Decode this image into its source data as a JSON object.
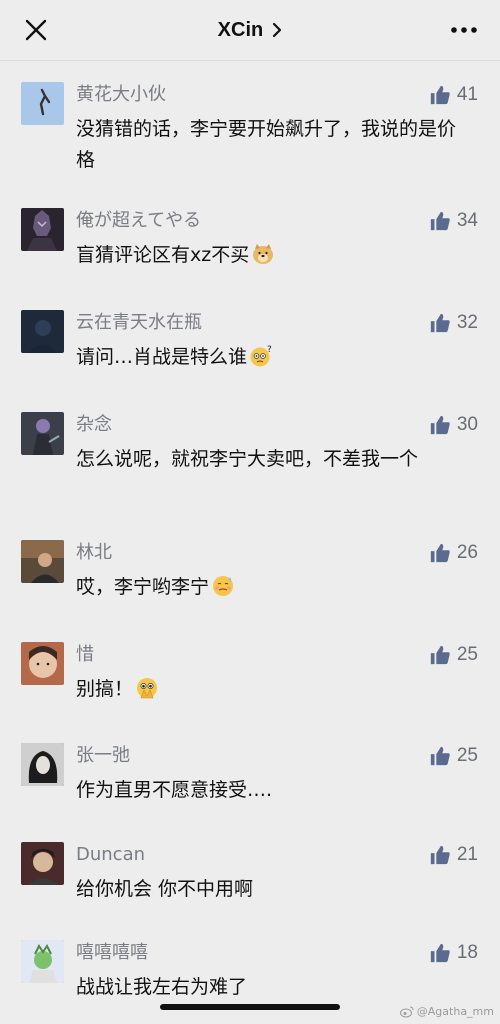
{
  "header": {
    "title": "XCin",
    "close_icon": "close-icon",
    "chevron_icon": "chevron-right-icon",
    "more_icon": "more-dots-icon"
  },
  "comments": [
    {
      "user": "黄花大小伙",
      "likes": "41",
      "text": "没猜错的话，李宁要开始飙升了，我说的是价格",
      "emoji": null,
      "avatar_color": "#a9c7e8"
    },
    {
      "user": "俺が超えてやる",
      "likes": "34",
      "text": "盲猜评论区有xz不买",
      "emoji": "doge-emoji",
      "avatar_color": "#2a2330"
    },
    {
      "user": "云在青天水在瓶",
      "likes": "32",
      "text": "请问…肖战是特么谁",
      "emoji": "confused-emoji",
      "avatar_color": "#1e2a3a"
    },
    {
      "user": "杂念",
      "likes": "30",
      "text": "怎么说呢，就祝李宁大卖吧，不差我一个",
      "emoji": null,
      "avatar_color": "#3b3f4a"
    },
    {
      "user": "林北",
      "likes": "26",
      "text": "哎，李宁哟李宁",
      "emoji": "sweat-emoji",
      "avatar_color": "#5a4a3a"
    },
    {
      "user": "惜",
      "likes": "25",
      "text": "别搞！",
      "emoji": "pray-emoji",
      "avatar_color": "#b46a4a"
    },
    {
      "user": "张一弛",
      "likes": "25",
      "text": "作为直男不愿意接受….",
      "emoji": null,
      "avatar_color": "#2b2b2b"
    },
    {
      "user": "Duncan",
      "likes": "21",
      "text": "给你机会 你不中用啊",
      "emoji": null,
      "avatar_color": "#4a2a2a"
    },
    {
      "user": "嘻嘻嘻嘻",
      "likes": "18",
      "text": "战战让我左右为难了",
      "emoji": null,
      "avatar_color": "#6fa05a"
    }
  ],
  "watermark": "@Agatha_mm",
  "colors": {
    "background": "#ededed",
    "name": "#7a7d84",
    "like": "#5a6b8f",
    "text": "#111111"
  }
}
